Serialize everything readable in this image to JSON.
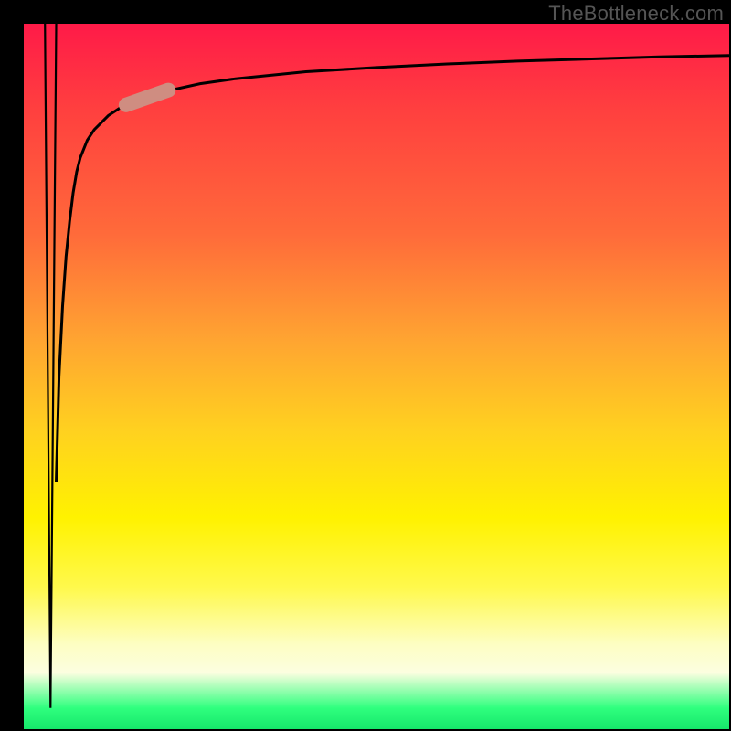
{
  "watermark": "TheBottleneck.com",
  "chart_data": {
    "type": "line",
    "title": "",
    "xlabel": "",
    "ylabel": "",
    "xlim": [
      0,
      100
    ],
    "ylim": [
      0,
      100
    ],
    "grid": false,
    "legend": false,
    "gradient_stops": [
      {
        "pos": 0.0,
        "color": "#ff1a48"
      },
      {
        "pos": 0.12,
        "color": "#ff3f3f"
      },
      {
        "pos": 0.3,
        "color": "#ff6b3a"
      },
      {
        "pos": 0.45,
        "color": "#ffa531"
      },
      {
        "pos": 0.58,
        "color": "#ffd21f"
      },
      {
        "pos": 0.7,
        "color": "#fff200"
      },
      {
        "pos": 0.8,
        "color": "#fff94d"
      },
      {
        "pos": 0.88,
        "color": "#fdfec3"
      },
      {
        "pos": 0.92,
        "color": "#fcfee0"
      },
      {
        "pos": 0.97,
        "color": "#2fff7e"
      },
      {
        "pos": 1.0,
        "color": "#16e86b"
      }
    ],
    "series": [
      {
        "name": "spike-down",
        "x": [
          3.0,
          3.8,
          4.6
        ],
        "y": [
          100,
          3,
          100
        ],
        "style": "thin"
      },
      {
        "name": "curve",
        "x": [
          4.6,
          5.0,
          5.5,
          6.0,
          6.5,
          7.0,
          7.5,
          8.0,
          9.0,
          10,
          12,
          14,
          16,
          18,
          20,
          25,
          30,
          40,
          50,
          60,
          70,
          80,
          90,
          100
        ],
        "y": [
          35,
          50,
          60,
          67,
          72,
          76,
          79,
          81,
          83.5,
          85,
          87,
          88.3,
          89.2,
          89.9,
          90.4,
          91.5,
          92.2,
          93.2,
          93.8,
          94.3,
          94.7,
          95.0,
          95.3,
          95.5
        ],
        "style": "medium"
      }
    ],
    "highlight_segment": {
      "x_range": [
        14.5,
        20.5
      ],
      "y_range": [
        88.5,
        90.6
      ],
      "color": "#cf8d81"
    }
  }
}
